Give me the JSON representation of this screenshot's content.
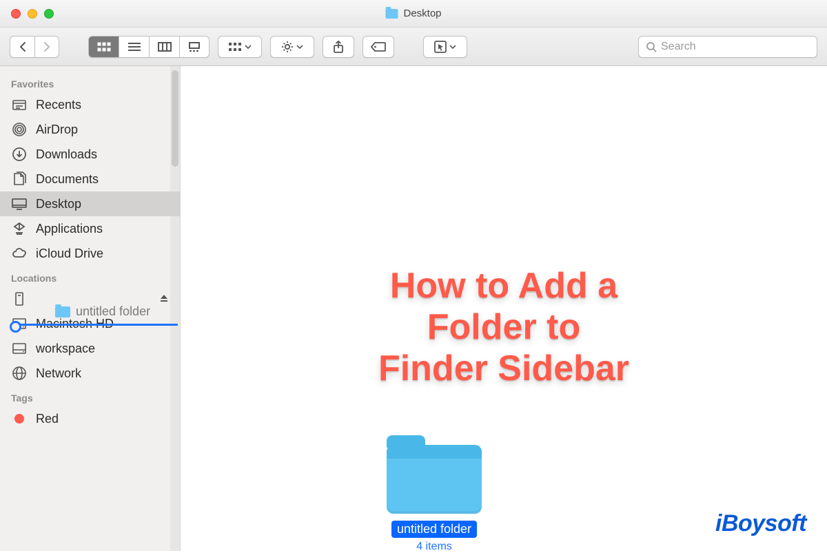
{
  "window": {
    "title": "Desktop"
  },
  "toolbar": {
    "search_placeholder": "Search"
  },
  "sidebar": {
    "sections": {
      "favorites": {
        "label": "Favorites"
      },
      "locations": {
        "label": "Locations"
      },
      "tags": {
        "label": "Tags"
      }
    },
    "favorites": [
      {
        "label": "Recents"
      },
      {
        "label": "AirDrop"
      },
      {
        "label": "Downloads"
      },
      {
        "label": "Documents"
      },
      {
        "label": "Desktop"
      },
      {
        "label": "Applications"
      },
      {
        "label": "iCloud Drive"
      }
    ],
    "locations": [
      {
        "label": ""
      },
      {
        "label": "Macintosh HD"
      },
      {
        "label": "workspace"
      },
      {
        "label": "Network"
      }
    ],
    "tags": [
      {
        "label": "Red"
      }
    ],
    "drag_proxy_label": "untitled folder"
  },
  "content": {
    "overlay_title_line1": "How to Add a Folder to",
    "overlay_title_line2": "Finder Sidebar",
    "folder": {
      "name": "untitled folder",
      "subtitle": "4 items"
    }
  },
  "brand": "iBoysoft"
}
